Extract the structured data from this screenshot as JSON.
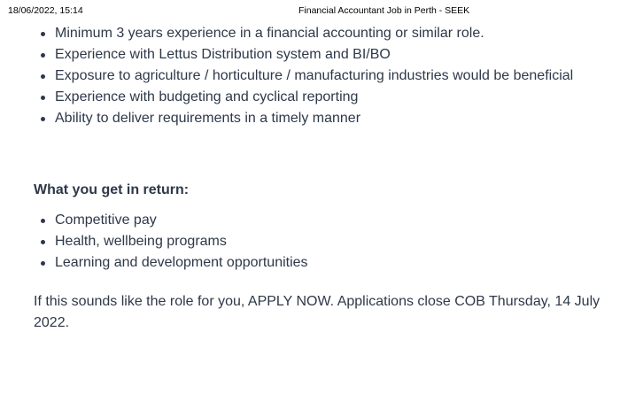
{
  "print_header": {
    "datetime": "18/06/2022, 15:14",
    "page_title": "Financial Accountant Job in Perth - SEEK"
  },
  "requirements": [
    "Minimum 3 years experience in a financial accounting or similar role.",
    "Experience with Lettus Distribution system and BI/BO",
    "Exposure to agriculture / horticulture / manufacturing industries would be beneficial",
    "Experience with budgeting and cyclical reporting",
    "Ability to deliver requirements in a timely manner"
  ],
  "benefits": {
    "heading": "What you get in return:",
    "items": [
      "Competitive pay",
      "Health, wellbeing programs",
      "Learning and development opportunities"
    ]
  },
  "closing_text": "If this sounds like the role for you, APPLY NOW. Applications close COB Thursday, 14 July 2022."
}
